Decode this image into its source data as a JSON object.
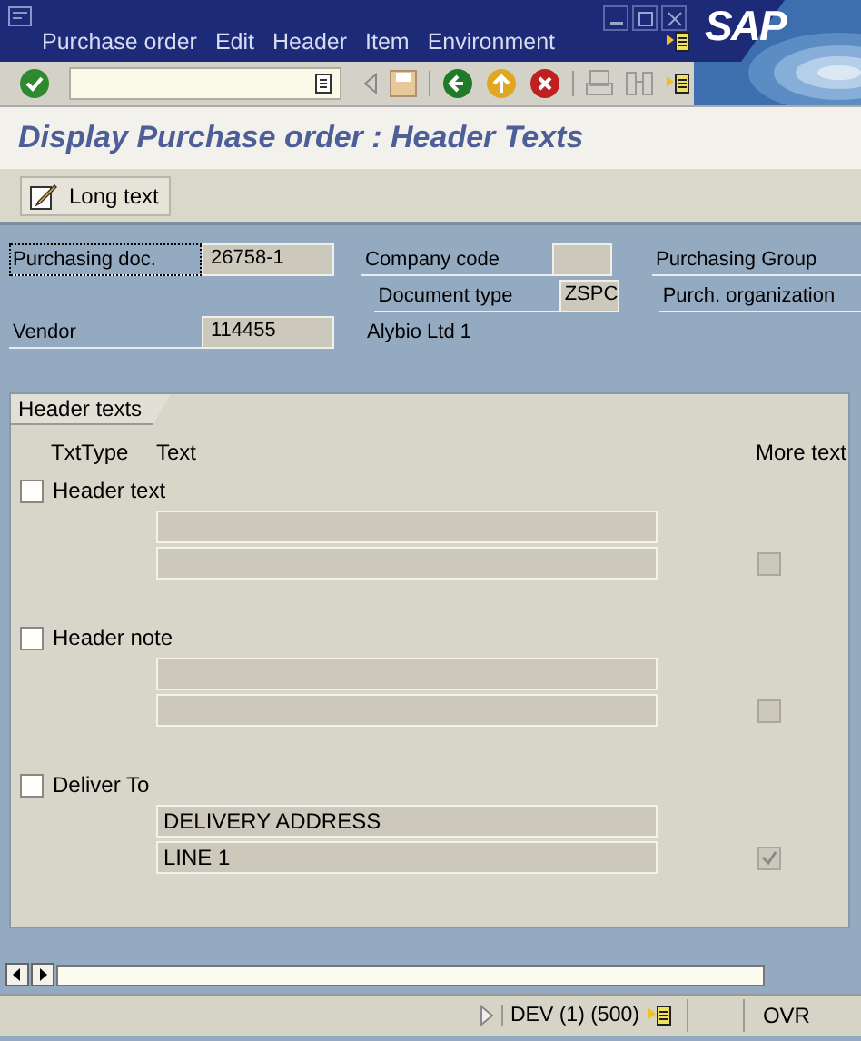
{
  "menu": [
    "Purchase order",
    "Edit",
    "Header",
    "Item",
    "Environment"
  ],
  "logo": "SAP",
  "title": "Display Purchase order : Header Texts",
  "app_toolbar": {
    "button": "Long text"
  },
  "header": {
    "purchasing_doc": {
      "label": "Purchasing doc.",
      "value": "26758-1",
      "focused": true
    },
    "company_code": {
      "label": "Company code"
    },
    "purchasing_group": {
      "label": "Purchasing Group"
    },
    "document_type": {
      "label": "Document type",
      "value": "ZSPC"
    },
    "purch_org": {
      "label": "Purch. organization"
    },
    "vendor": {
      "label": "Vendor",
      "value": "114455"
    },
    "vendor_name": "Alybio Ltd 1"
  },
  "tabs": [
    {
      "label": "Header texts",
      "selected": true
    }
  ],
  "columns": [
    "TxtType",
    "Text",
    "More text"
  ],
  "groups": [
    {
      "label": "Header text",
      "checked": false,
      "more_text": false,
      "lines": [
        {
          "kind": "empty"
        },
        {
          "kind": "empty"
        }
      ]
    },
    {
      "label": "Header note",
      "checked": false,
      "more_text": false,
      "lines": [
        {
          "kind": "empty"
        },
        {
          "kind": "empty"
        }
      ]
    },
    {
      "label": "Deliver To",
      "checked": false,
      "more_text": true,
      "lines": [
        {
          "kind": "text",
          "text": "DELIVERY ADDRESS"
        },
        {
          "kind": "text",
          "text": "LINE 1"
        }
      ]
    }
  ],
  "status_bar": {
    "system": "DEV (1) (500)",
    "mode": "OVR"
  }
}
